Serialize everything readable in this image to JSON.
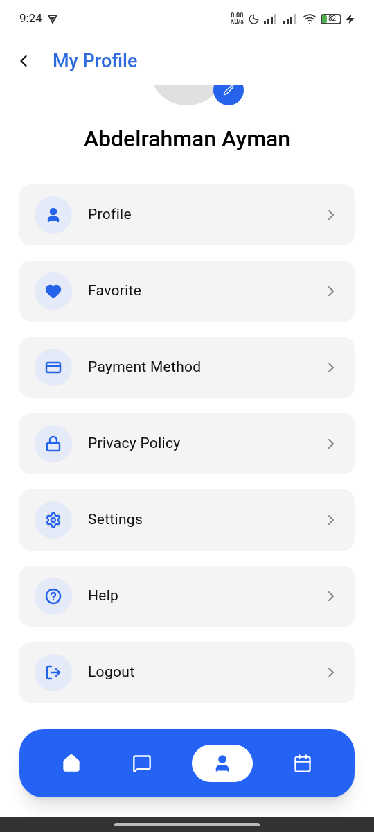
{
  "status_bar": {
    "time": "9:24",
    "net_speed": "0.00",
    "net_unit": "KB/s",
    "battery": "82"
  },
  "header": {
    "title": "My Profile"
  },
  "profile": {
    "name": "Abdelrahman Ayman"
  },
  "menu": [
    {
      "kind": "profile",
      "label": "Profile"
    },
    {
      "kind": "favorite",
      "label": "Favorite"
    },
    {
      "kind": "payment",
      "label": "Payment Method"
    },
    {
      "kind": "privacy",
      "label": "Privacy Policy"
    },
    {
      "kind": "settings",
      "label": "Settings"
    },
    {
      "kind": "help",
      "label": "Help"
    },
    {
      "kind": "logout",
      "label": "Logout"
    }
  ],
  "nav": [
    {
      "kind": "home",
      "selected": false
    },
    {
      "kind": "chat",
      "selected": false
    },
    {
      "kind": "profile",
      "selected": true
    },
    {
      "kind": "calendar",
      "selected": false
    }
  ]
}
